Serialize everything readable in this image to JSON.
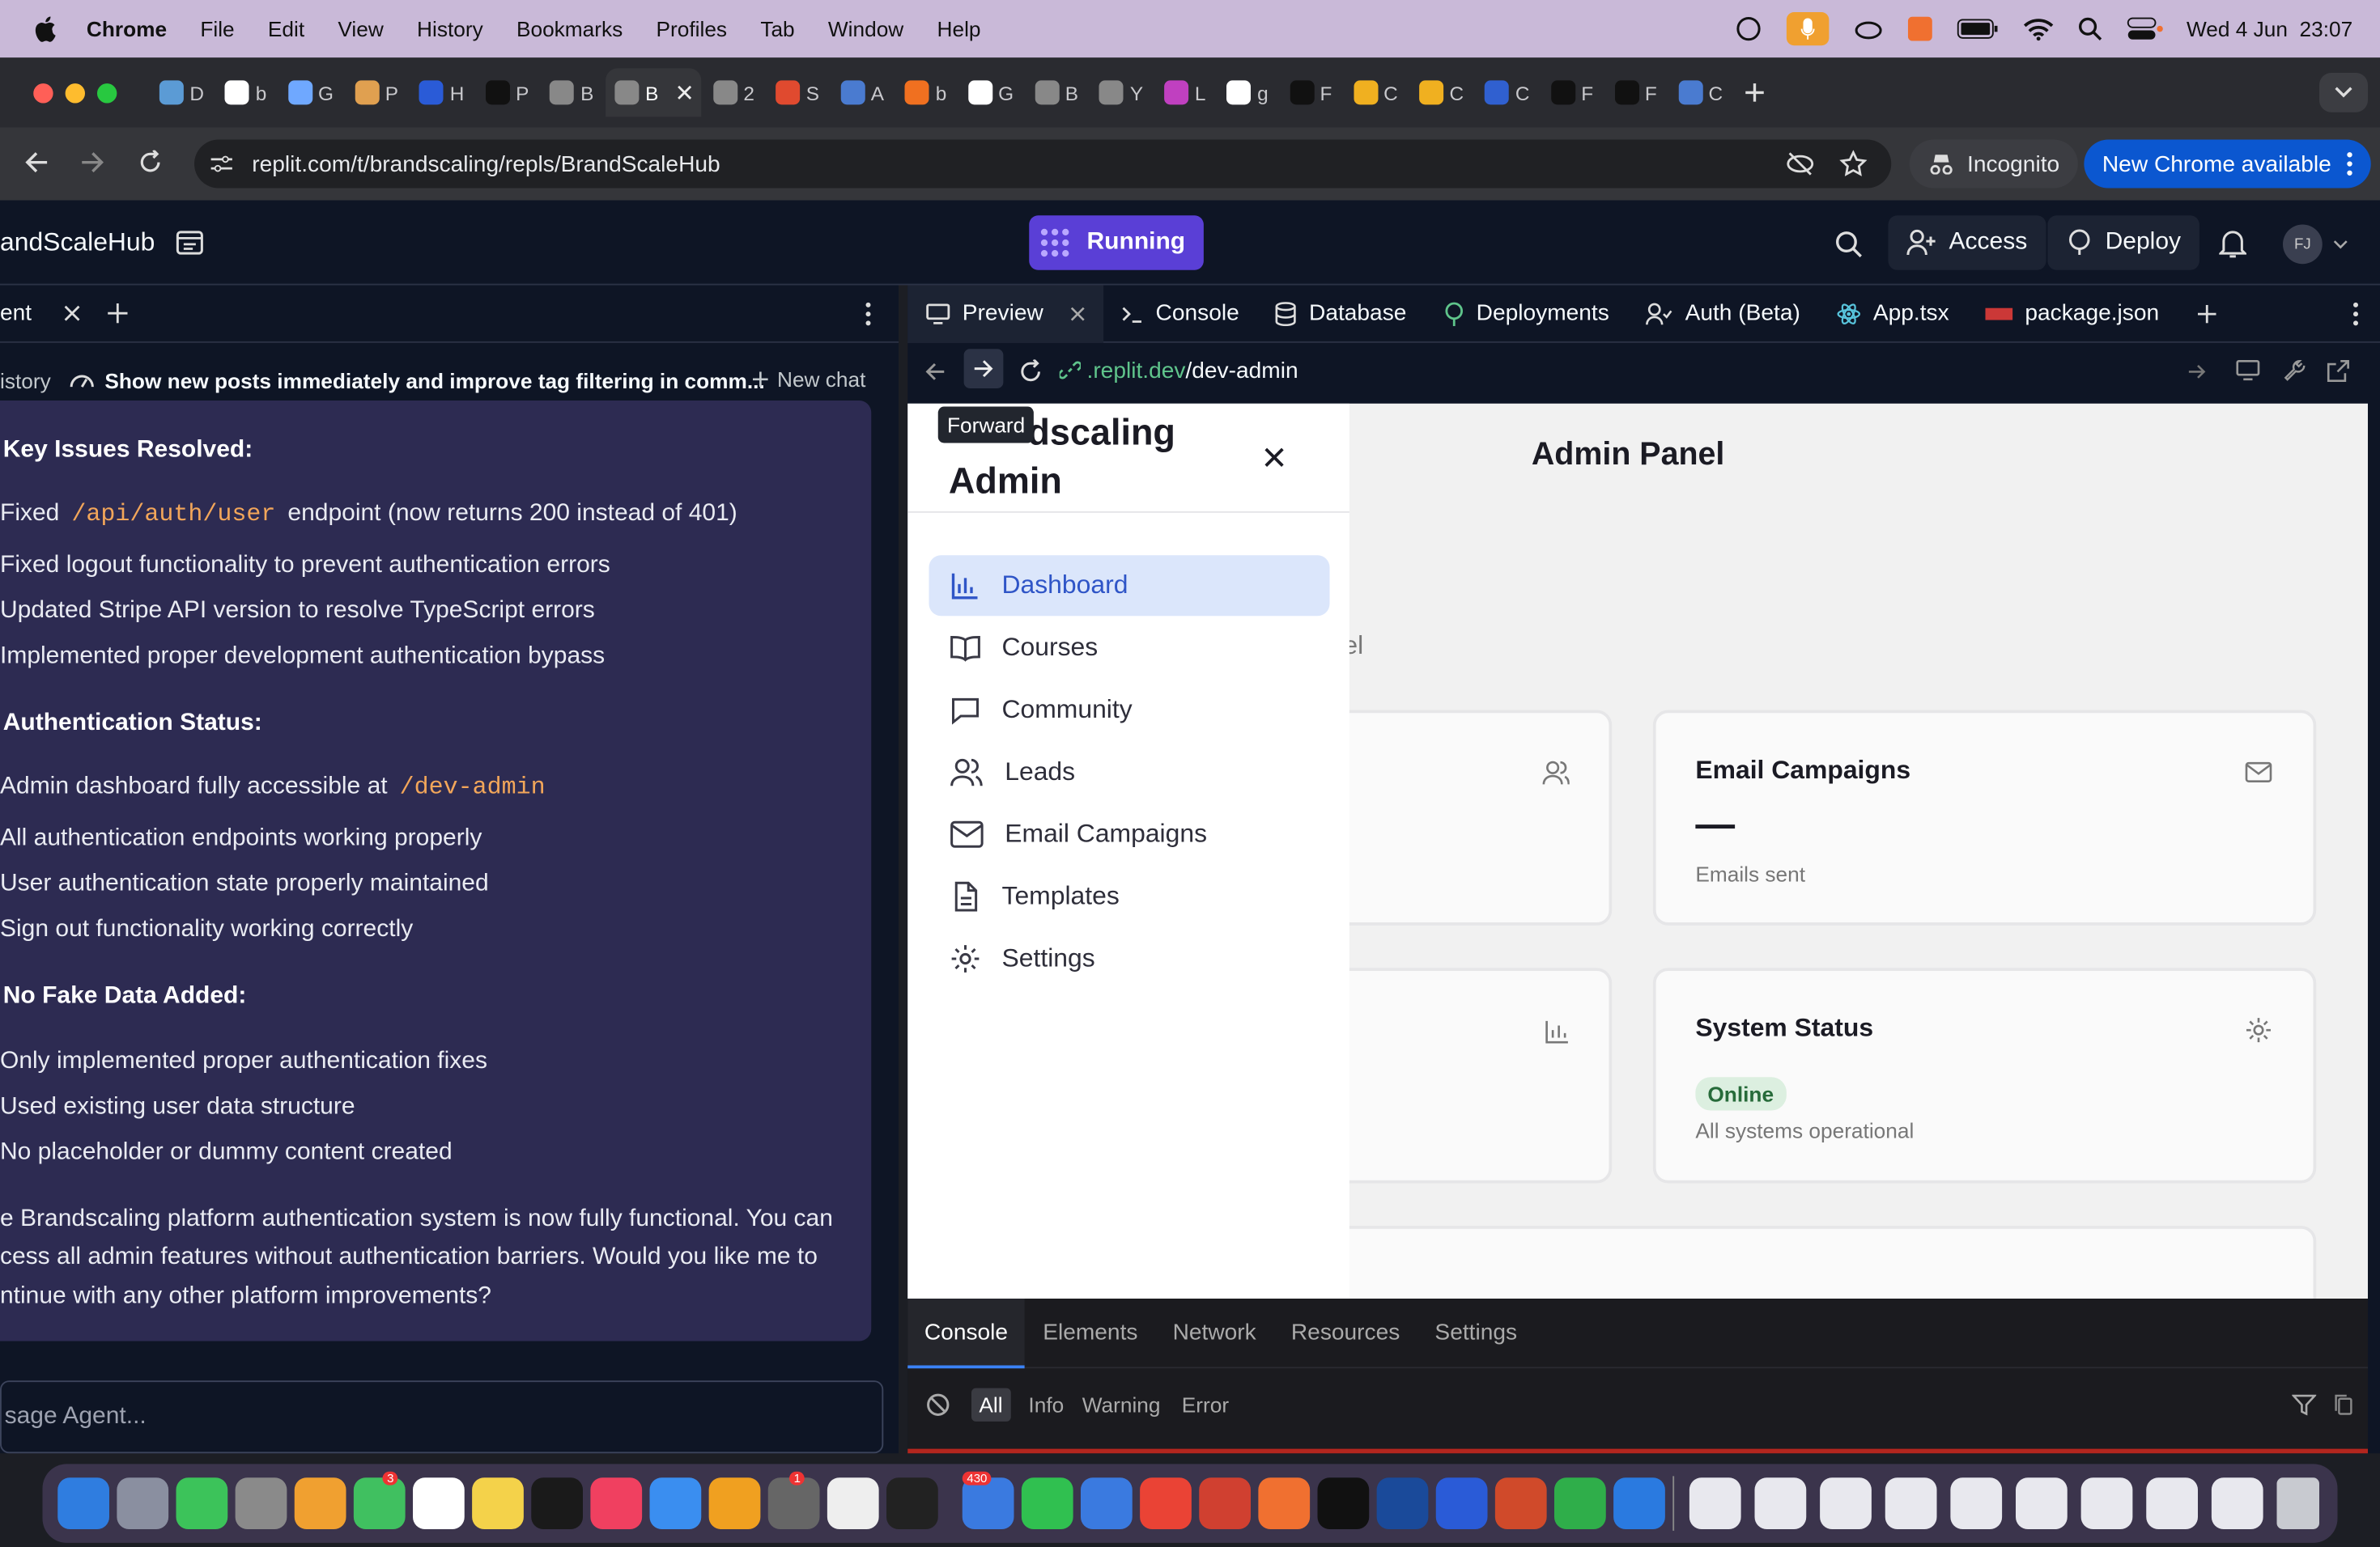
{
  "menubar": {
    "app": "Chrome",
    "items": [
      "File",
      "Edit",
      "View",
      "History",
      "Bookmarks",
      "Profiles",
      "Tab",
      "Window",
      "Help"
    ],
    "datetime": "Wed 4 Jun  23:07"
  },
  "tabs": [
    {
      "label": "D",
      "color": "#5b9bd5"
    },
    {
      "label": "b",
      "color": "#ffffff"
    },
    {
      "label": "G",
      "color": "#6fa8ff"
    },
    {
      "label": "P",
      "color": "#e0a050"
    },
    {
      "label": "H",
      "color": "#2a5bd7"
    },
    {
      "label": "P",
      "color": "#111111"
    },
    {
      "label": "B",
      "color": "#888888"
    },
    {
      "label": "B",
      "color": "#888888",
      "active": true
    },
    {
      "label": "2",
      "color": "#888888"
    },
    {
      "label": "S",
      "color": "#e04a2f"
    },
    {
      "label": "A",
      "color": "#4a7bd0"
    },
    {
      "label": "b",
      "color": "#f07020"
    },
    {
      "label": "G",
      "color": "#ffffff"
    },
    {
      "label": "B",
      "color": "#888888"
    },
    {
      "label": "Y",
      "color": "#888888"
    },
    {
      "label": "L",
      "color": "#c040c0"
    },
    {
      "label": "g",
      "color": "#ffffff"
    },
    {
      "label": "F",
      "color": "#111111"
    },
    {
      "label": "C",
      "color": "#f0b020"
    },
    {
      "label": "C",
      "color": "#f0b020"
    },
    {
      "label": "C",
      "color": "#3060d0"
    },
    {
      "label": "F",
      "color": "#111111"
    },
    {
      "label": "F",
      "color": "#111111"
    },
    {
      "label": "C",
      "color": "#4a7bd0"
    }
  ],
  "toolbar": {
    "url": "replit.com/t/brandscaling/repls/BrandScaleHub",
    "incognito": "Incognito",
    "update": "New Chrome available"
  },
  "replit": {
    "project": "andScaleHub",
    "run_status": "Running",
    "access": "Access",
    "deploy": "Deploy",
    "avatar": "FJ"
  },
  "agent": {
    "tab_label": "ent",
    "history_label": "istory",
    "chat_title": "Show new posts immediately and improve tag filtering in comm...",
    "new_chat": "New chat",
    "composer_placeholder": "sage Agent...",
    "sections": {
      "key_heading": "Key Issues Resolved:",
      "key_1_pre": "Fixed",
      "key_1_code": "/api/auth/user",
      "key_1_post": "endpoint (now returns 200 instead of 401)",
      "key_2": "Fixed logout functionality to prevent authentication errors",
      "key_3": "Updated Stripe API version to resolve TypeScript errors",
      "key_4": "Implemented proper development authentication bypass",
      "auth_heading": "Authentication Status:",
      "auth_1_pre": "Admin dashboard fully accessible at",
      "auth_1_code": "/dev-admin",
      "auth_2": "All authentication endpoints working properly",
      "auth_3": "User authentication state properly maintained",
      "auth_4": "Sign out functionality working correctly",
      "fake_heading": "No Fake Data Added:",
      "fake_1": "Only implemented proper authentication fixes",
      "fake_2": "Used existing user data structure",
      "fake_3": "No placeholder or dummy content created",
      "closing_1": "e Brandscaling platform authentication system is now fully functional. You can",
      "closing_2": "cess all admin features without authentication barriers. Would you like me to",
      "closing_3": "ntinue with any other platform improvements?"
    }
  },
  "workspace": {
    "tabs": [
      "Preview",
      "Console",
      "Database",
      "Deployments",
      "Auth (Beta)",
      "App.tsx",
      "package.json"
    ],
    "preview_url_host": ".replit.dev",
    "preview_url_path": "/dev-admin",
    "tooltip": "Forward"
  },
  "app": {
    "brand_line1": "dscaling",
    "brand_line2": "Admin",
    "page_title": "Admin Panel",
    "partial_text": "el",
    "nav": [
      "Dashboard",
      "Courses",
      "Community",
      "Leads",
      "Email Campaigns",
      "Templates",
      "Settings"
    ],
    "cards": {
      "email_title": "Email Campaigns",
      "email_value": "—",
      "email_sub": "Emails sent",
      "status_title": "System Status",
      "status_badge": "Online",
      "status_sub": "All systems operational"
    }
  },
  "devtools": {
    "tabs": [
      "Console",
      "Elements",
      "Network",
      "Resources",
      "Settings"
    ],
    "filters": [
      "All",
      "Info",
      "Warning",
      "Error"
    ]
  },
  "dock": {
    "colors": [
      "#2f7de0",
      "#8a8fa0",
      "#3cc35a",
      "#8a8a8a",
      "#f0a030",
      "#40c060",
      "#ffffff",
      "#f4d24a",
      "#1a1a1a",
      "#f04060",
      "#3a8ef0",
      "#f0a020",
      "#666666",
      "#eeeeee",
      "#222222",
      "#3a7ae0",
      "#30c050",
      "#3a7ae0",
      "#ea4335",
      "#d04030",
      "#f07030",
      "#111111",
      "#1a4a9a",
      "#2a5bd7",
      "#d04a2a",
      "#2fae4a",
      "#2a7ae0"
    ],
    "badges": {
      "facetime": "3",
      "mail": "430",
      "settings": "1"
    }
  }
}
